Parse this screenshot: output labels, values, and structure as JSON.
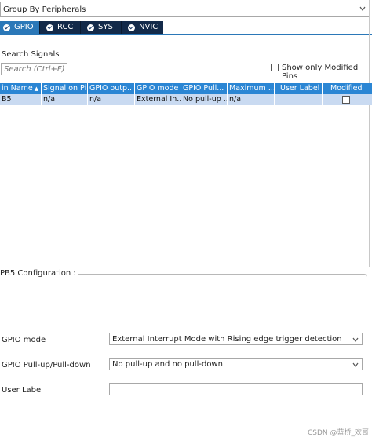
{
  "group_selector": {
    "value": "Group By Peripherals",
    "icon": "chevron-down-icon"
  },
  "tabs": [
    {
      "label": "GPIO",
      "active": true
    },
    {
      "label": "RCC",
      "active": false
    },
    {
      "label": "SYS",
      "active": false
    },
    {
      "label": "NVIC",
      "active": false
    }
  ],
  "search": {
    "label": "Search Signals",
    "placeholder": "Search (Ctrl+F)",
    "show_modified_label": "Show only Modified Pins",
    "show_modified_checked": false
  },
  "table": {
    "columns": [
      "in Name",
      "Signal on Pin",
      "GPIO outp...",
      "GPIO mode",
      "GPIO Pull...",
      "Maximum ...",
      "User Label",
      "Modified"
    ],
    "rows": [
      {
        "cells": [
          "B5",
          "n/a",
          "n/a",
          "External In...",
          "No pull-up ...",
          "n/a",
          "",
          ""
        ],
        "modified": false
      }
    ],
    "header_color": "#2b86d4",
    "selected_row_color": "#c9daf1"
  },
  "config": {
    "title": "PB5 Configuration :",
    "gpio_mode_label": "GPIO mode",
    "gpio_mode_value": "External Interrupt Mode with Rising edge trigger detection",
    "pull_label": "GPIO Pull-up/Pull-down",
    "pull_value": "No pull-up and no pull-down",
    "user_label_label": "User Label",
    "user_label_value": ""
  },
  "watermark": "CSDN @蓝桥_欢哥",
  "colors": {
    "tab_bar": "#132a4a",
    "tab_active": "#2b78b8"
  }
}
